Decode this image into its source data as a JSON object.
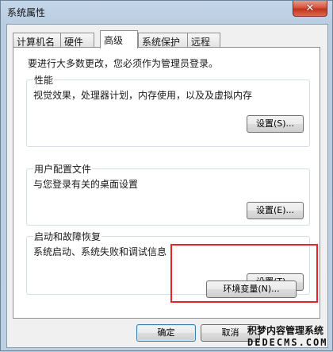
{
  "window": {
    "title": "系统属性",
    "close_glyph": "✕"
  },
  "tabs": [
    {
      "label": "计算机名",
      "active": false
    },
    {
      "label": "硬件",
      "active": false
    },
    {
      "label": "高级",
      "active": true
    },
    {
      "label": "系统保护",
      "active": false
    },
    {
      "label": "远程",
      "active": false
    }
  ],
  "advanced": {
    "admin_note": "要进行大多数更改，您必须作为管理员登录。",
    "performance": {
      "title": "性能",
      "description": "视觉效果，处理器计划，内存使用，以及及虚拟内存",
      "button": "设置(S)..."
    },
    "user_profiles": {
      "title": "用户配置文件",
      "description": "与您登录有关的桌面设置",
      "button": "设置(E)..."
    },
    "startup_recovery": {
      "title": "启动和故障恢复",
      "description": "系统启动、系统失败和调试信息",
      "button": "设置(T)..."
    },
    "env_vars_button": "环境变量(N)..."
  },
  "footer": {
    "ok_button": "确定",
    "cancel_button": "取消"
  },
  "watermark": {
    "line1": "积梦内容管理系统",
    "line2": "DEDECMS.COM"
  },
  "colors": {
    "highlight_border": "#e8232b",
    "close_button": "#c3321d"
  }
}
